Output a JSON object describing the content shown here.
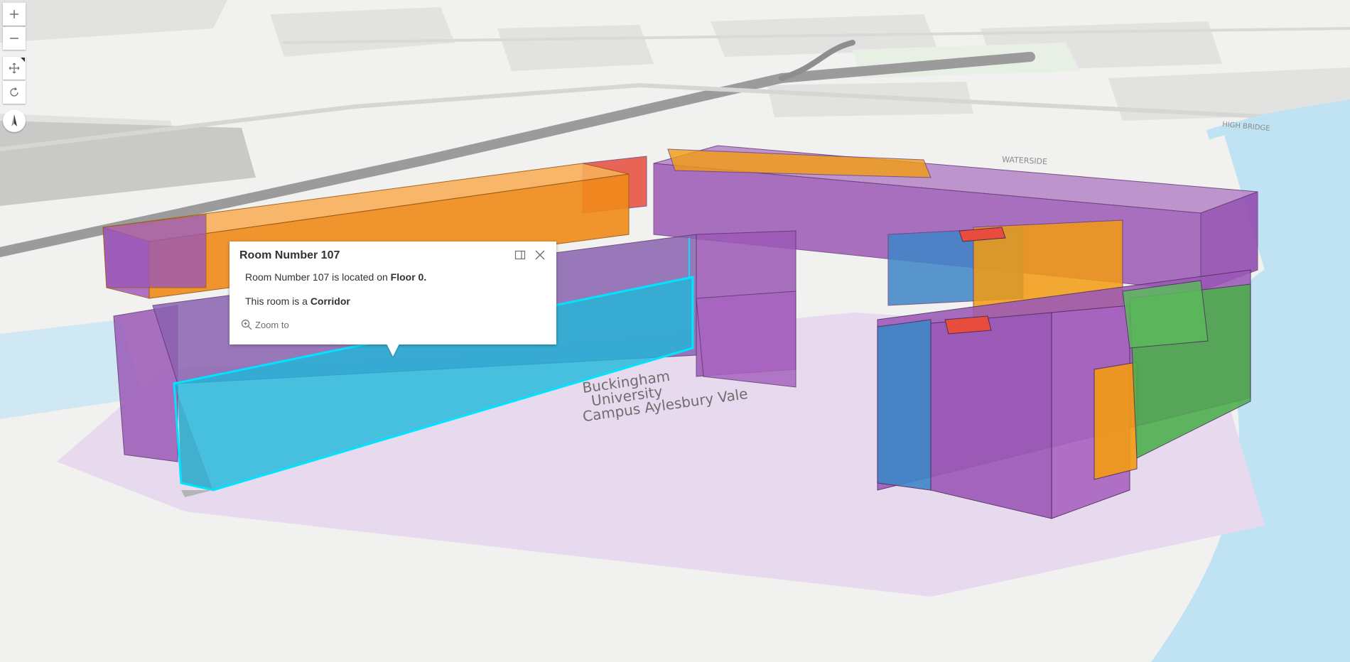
{
  "map": {
    "campus_label_lines": [
      "Buckingham",
      "University",
      "Campus Aylesbury Vale"
    ],
    "street_labels": [
      "WATERSIDE",
      "HIGH BRIDGE"
    ],
    "colors": {
      "background": "#f1f1ef",
      "water": "#bfe3f2",
      "campus_ground": "#e7d9ee",
      "purple_room": "#9b59b6",
      "orange_room": "#f39c12",
      "red_room": "#e74c3c",
      "blue_room": "#3f86c8",
      "green_room": "#4cae4c",
      "selected_room": "#1fb8d9",
      "selection_outline": "#00e5ff"
    }
  },
  "controls": {
    "zoom_in_icon": "plus-icon",
    "zoom_out_icon": "minus-icon",
    "pan_icon": "move-icon",
    "rotate_icon": "rotate-icon",
    "compass_icon": "compass-icon"
  },
  "popup": {
    "title": "Room Number 107",
    "line1_prefix": "Room Number 107 is located on ",
    "line1_value": "Floor 0.",
    "line2_prefix": "This room is a ",
    "line2_value": "Corridor",
    "zoom_to_label": "Zoom to",
    "dock_icon": "dock-icon",
    "close_icon": "close-icon",
    "zoom_icon": "zoom-to-icon"
  }
}
